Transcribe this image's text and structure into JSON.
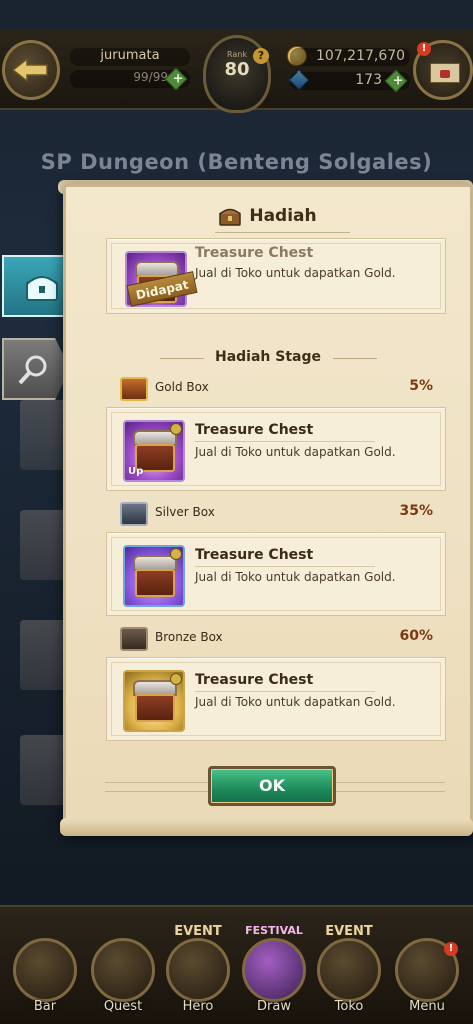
{
  "hud": {
    "player_name": "jurumata",
    "stamina": "99/99",
    "rank_label": "Rank",
    "rank_value": "80",
    "gold": "107,217,670",
    "gems": "173",
    "mail_alert": "!"
  },
  "background": {
    "dungeon_title": "SP Dungeon (Benteng Solgales)"
  },
  "dialog": {
    "title": "Hadiah",
    "first_reward": {
      "name": "Treasure Chest",
      "desc": "Jual di Toko untuk dapatkan Gold.",
      "status": "Didapat"
    },
    "stage_title": "Hadiah Stage",
    "boxes": [
      {
        "label": "Gold Box",
        "rate": "5%",
        "item_name": "Treasure Chest",
        "item_desc": "Jual di Toko untuk dapatkan Gold.",
        "tag": "Up"
      },
      {
        "label": "Silver Box",
        "rate": "35%",
        "item_name": "Treasure Chest",
        "item_desc": "Jual di Toko untuk dapatkan Gold."
      },
      {
        "label": "Bronze Box",
        "rate": "60%",
        "item_name": "Treasure Chest",
        "item_desc": "Jual di Toko untuk dapatkan Gold."
      }
    ],
    "ok_label": "OK"
  },
  "nav": {
    "items": [
      {
        "label": "Bar"
      },
      {
        "label": "Quest"
      },
      {
        "label": "Hero",
        "event": "EVENT"
      },
      {
        "label": "Draw",
        "event": "FESTIVAL"
      },
      {
        "label": "Toko",
        "event": "EVENT"
      },
      {
        "label": "Menu",
        "alert": "!"
      }
    ]
  },
  "colors": {
    "ok_button": "#1e8a5a",
    "active_tab": "#3aa7b8",
    "rate_text": "#7c3a14"
  }
}
